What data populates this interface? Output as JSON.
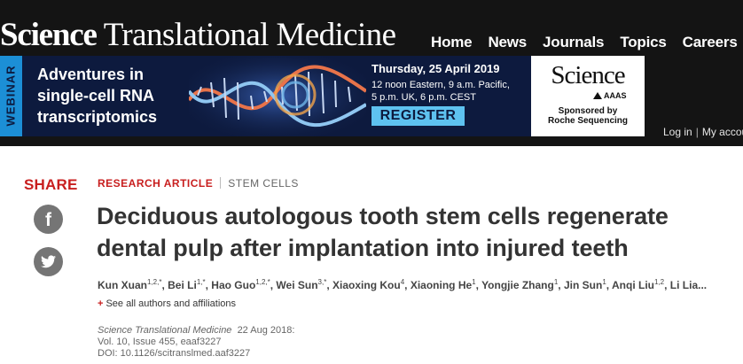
{
  "header": {
    "masthead_part1": "Science",
    "masthead_part2": " Translational Medicine",
    "nav": [
      "Home",
      "News",
      "Journals",
      "Topics",
      "Careers"
    ],
    "login": {
      "login_label": "Log in",
      "account_label": "My accoun"
    }
  },
  "ad": {
    "tab_label": "WEBINAR",
    "title_lines": [
      "Adventures in",
      "single-cell RNA",
      "transcriptomics"
    ],
    "date": "Thursday, 25 April 2019",
    "time_lines": [
      "12 noon Eastern, 9 a.m. Pacific,",
      "5 p.m. UK, 6 p.m. CEST"
    ],
    "register_label": "REGISTER",
    "sponsor_logo": "Science",
    "sponsor_org": "AAAS",
    "sponsor_text_lines": [
      "Sponsored by",
      "Roche Sequencing"
    ]
  },
  "share": {
    "label": "SHARE",
    "facebook_glyph": "f",
    "icons": [
      "facebook-icon",
      "twitter-icon"
    ]
  },
  "article": {
    "type": "RESEARCH ARTICLE",
    "subject": "STEM CELLS",
    "title_lines": [
      "Deciduous autologous tooth stem cells regenerate",
      "dental pulp after implantation into injured teeth"
    ],
    "authors": [
      {
        "name": "Kun Xuan",
        "sup": "1,2,*"
      },
      {
        "name": "Bei Li",
        "sup": "1,*"
      },
      {
        "name": "Hao Guo",
        "sup": "1,2,*"
      },
      {
        "name": "Wei Sun",
        "sup": "3,*"
      },
      {
        "name": "Xiaoxing Kou",
        "sup": "4"
      },
      {
        "name": "Xiaoning He",
        "sup": "1"
      },
      {
        "name": "Yongjie Zhang",
        "sup": "1"
      },
      {
        "name": "Jin Sun",
        "sup": "1"
      },
      {
        "name": "Anqi Liu",
        "sup": "1,2"
      },
      {
        "name": "Li Lia...",
        "sup": ""
      }
    ],
    "see_all_plus": "+",
    "see_all_label": "See all authors and affiliations",
    "citation": {
      "journal": "Science Translational Medicine",
      "date": "22 Aug 2018:",
      "volume_line": "Vol. 10, Issue 455, eaaf3227",
      "doi_line": "DOI: 10.1126/scitranslmed.aaf3227"
    }
  },
  "colors": {
    "accent_red": "#c81e1e",
    "header_bg": "#141414",
    "banner_bg": "#0d1a3e",
    "register_bg": "#5ec2f0"
  }
}
